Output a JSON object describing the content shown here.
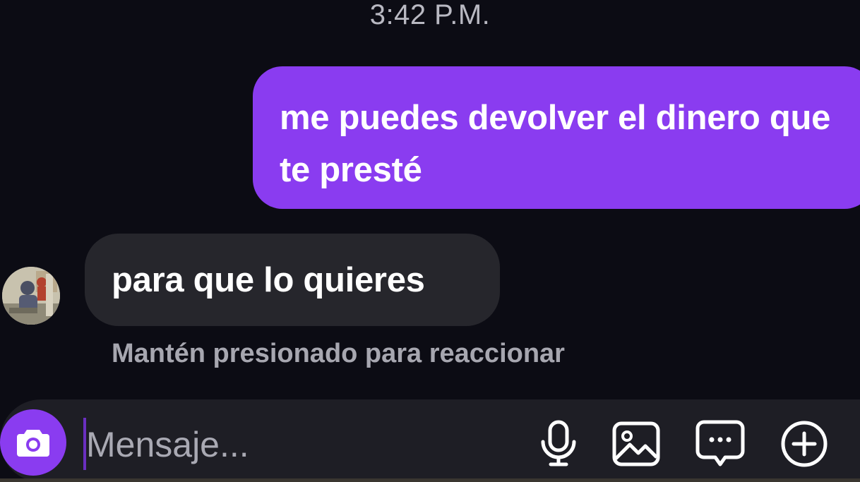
{
  "chat": {
    "timestamp": "3:42 P.M.",
    "messages": [
      {
        "direction": "sent",
        "text": "me puedes devolver el dinero que te presté"
      },
      {
        "direction": "received",
        "text": "para que lo quieres"
      }
    ],
    "reaction_hint": "Mantén presionado para reaccionar"
  },
  "composer": {
    "placeholder": "Mensaje...",
    "icons": [
      "camera-icon",
      "microphone-icon",
      "image-icon",
      "chat-bubble-icon",
      "plus-circle-icon"
    ]
  },
  "colors": {
    "sent_bubble": "#8a3cf0",
    "received_bubble": "#26262c",
    "background": "#0c0c14",
    "composer": "#1e1e25"
  }
}
